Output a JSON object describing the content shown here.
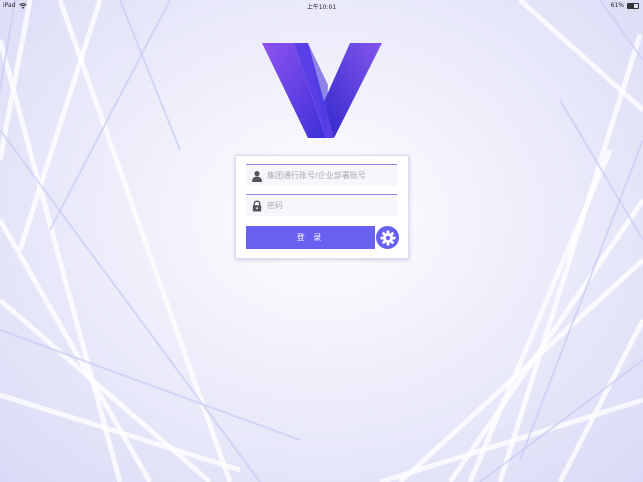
{
  "status_bar": {
    "device": "iPad",
    "time": "上午10:01",
    "battery": "61%",
    "battery_level": 0.61
  },
  "login": {
    "account_placeholder": "集团通行账号/企业部署账号",
    "password_placeholder": "密码",
    "login_label": "登 录"
  },
  "icons": {
    "wifi": "wifi-icon",
    "battery": "battery-icon",
    "user": "user-icon",
    "lock": "lock-icon",
    "settings": "gear-icon",
    "logo": "v-logo"
  },
  "colors": {
    "accent": "#6860f0",
    "logo_dark": "#3d2fd8",
    "logo_light": "#8e53f0",
    "field_border": "#8a84e8"
  }
}
